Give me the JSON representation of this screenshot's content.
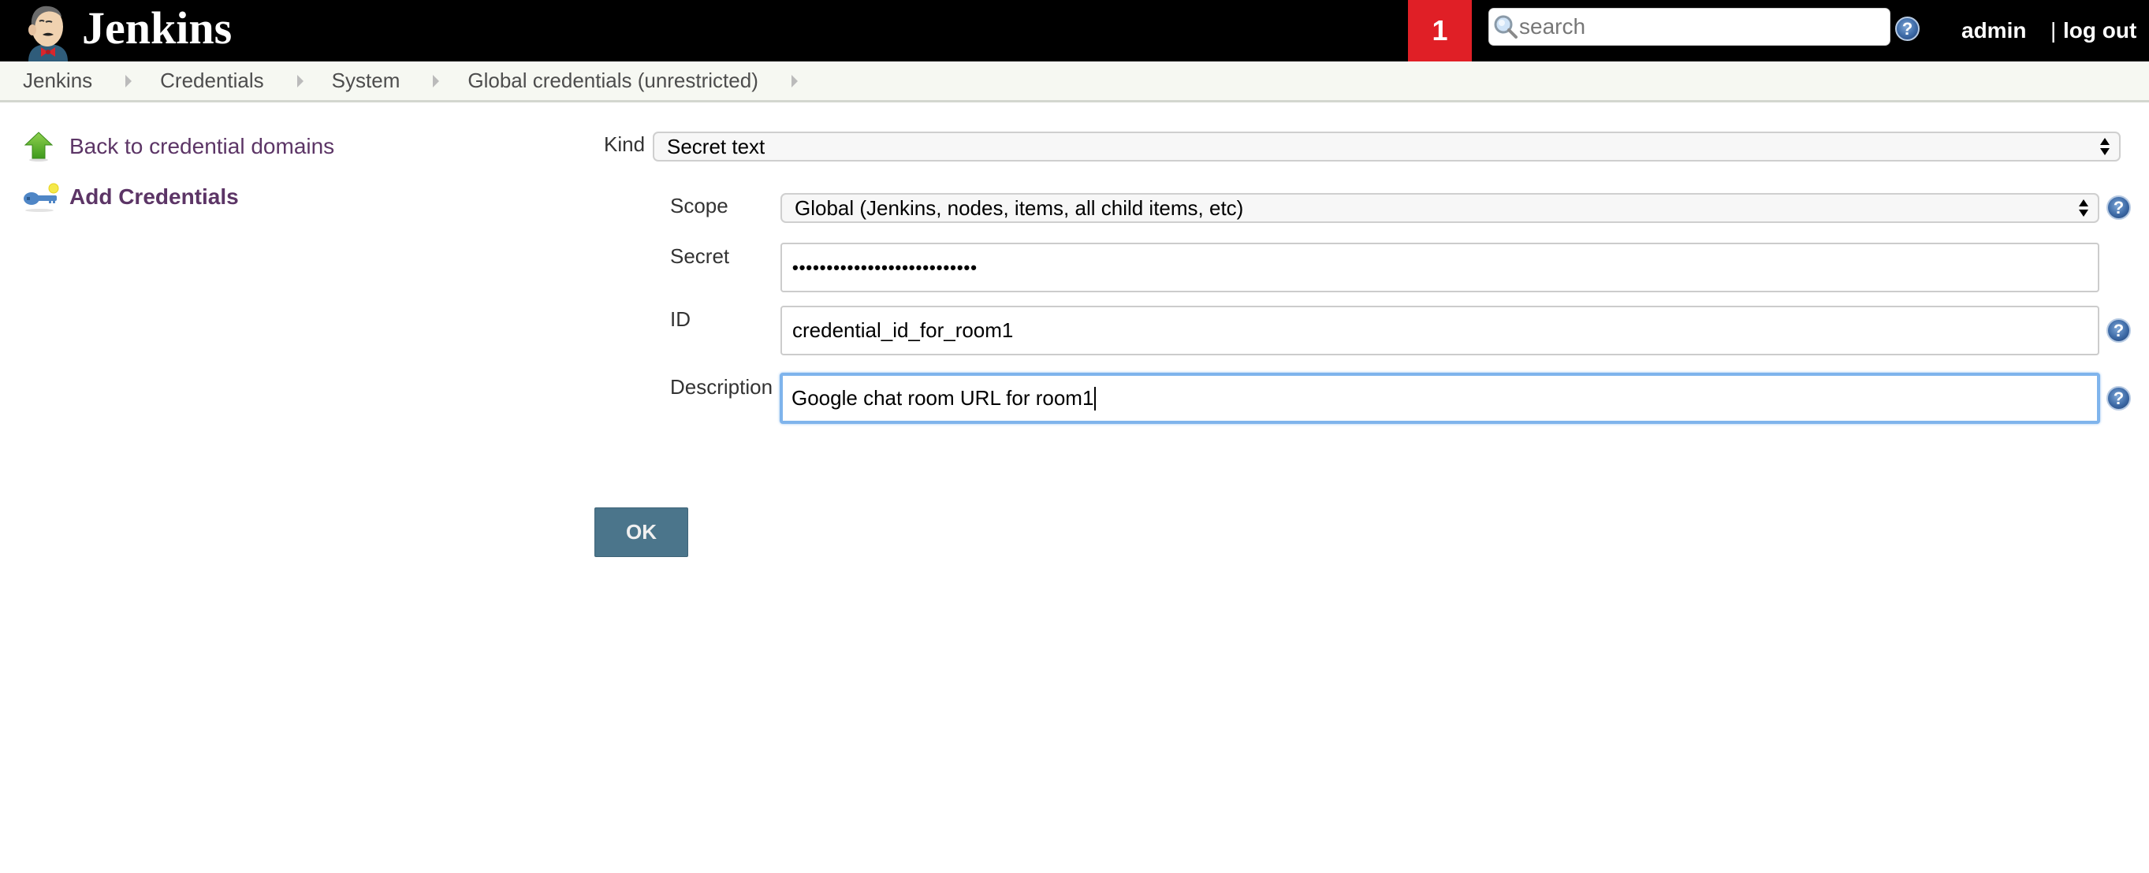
{
  "header": {
    "app_title": "Jenkins",
    "notification_count": "1",
    "search": {
      "placeholder": "search",
      "value": ""
    },
    "user": "admin",
    "separator": "|",
    "logout_label": "log out",
    "colors": {
      "background": "#000000",
      "badge": "#e01f26"
    }
  },
  "breadcrumbs": [
    {
      "label": "Jenkins"
    },
    {
      "label": "Credentials"
    },
    {
      "label": "System"
    },
    {
      "label": "Global credentials (unrestricted)"
    }
  ],
  "sidebar": {
    "items": [
      {
        "label": "Back to credential domains",
        "icon": "up-arrow-icon"
      },
      {
        "label": "Add Credentials",
        "icon": "key-icon"
      }
    ]
  },
  "form": {
    "kind": {
      "label": "Kind",
      "value": "Secret text"
    },
    "scope": {
      "label": "Scope",
      "value": "Global (Jenkins, nodes, items, all child items, etc)"
    },
    "secret": {
      "label": "Secret",
      "masked_value": "•••••••••••••••••••••••••••"
    },
    "id": {
      "label": "ID",
      "value": "credential_id_for_room1"
    },
    "description": {
      "label": "Description",
      "value": "Google chat room URL for room1"
    },
    "help_symbol": "?",
    "ok_label": "OK",
    "colors": {
      "ok_button": "#4b758b",
      "focus_ring": "#7fb4ec",
      "link": "#5c3566"
    }
  }
}
